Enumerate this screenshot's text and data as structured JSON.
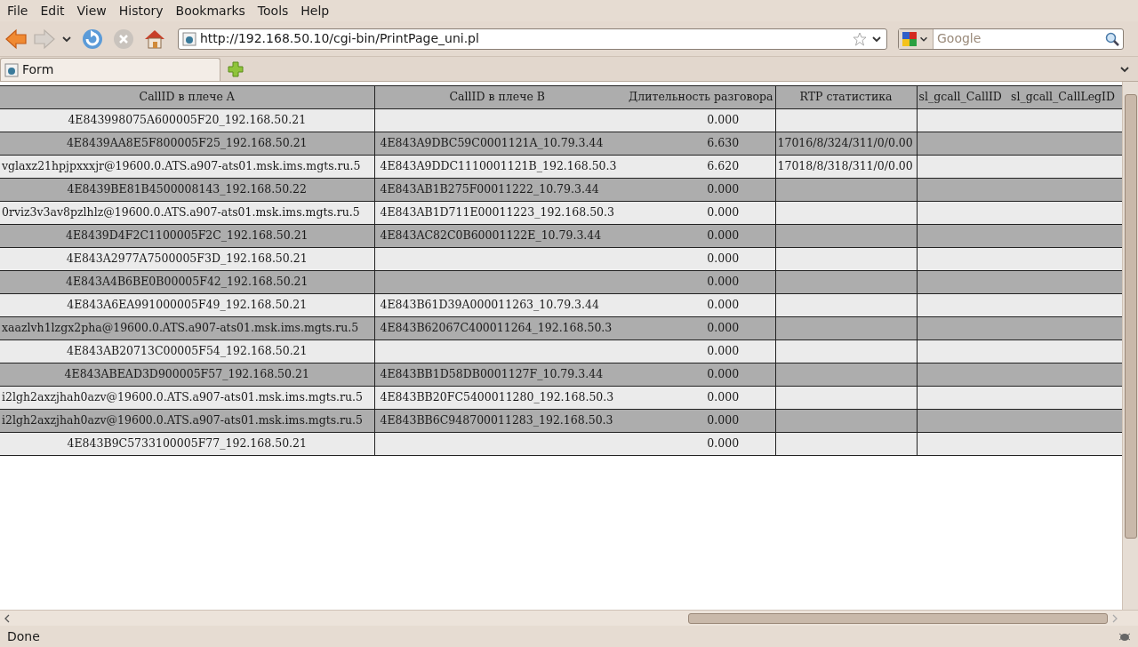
{
  "menu": [
    "File",
    "Edit",
    "View",
    "History",
    "Bookmarks",
    "Tools",
    "Help"
  ],
  "address_bar": {
    "url": "http://192.168.50.10/cgi-bin/PrintPage_uni.pl"
  },
  "search": {
    "placeholder": "Google"
  },
  "tabs": [
    {
      "label": "Form",
      "selected": true
    }
  ],
  "table": {
    "columns": [
      "CallID в плече A",
      "CallID в плече B",
      "Длительность разговора",
      "RTP статистика",
      "sl_gcall_CallID",
      "sl_gcall_CallLegID"
    ],
    "rows": [
      {
        "call_a": "4E843998075A600005F20_192.168.50.21",
        "duration": "0.000"
      },
      {
        "call_a": "4E8439AA8E5F800005F25_192.168.50.21",
        "call_b": "4E843A9DBC59C0001121A_10.79.3.44",
        "duration": "6.630",
        "rtp": "17016/8/324/311/0/0.00"
      },
      {
        "call_a": "vglaxz21hpjpxxxjr@19600.0.ATS.a907-ats01.msk.ims.mgts.ru.5",
        "call_b": "4E843A9DDC1110001121B_192.168.50.3",
        "duration": "6.620",
        "rtp": "17018/8/318/311/0/0.00"
      },
      {
        "call_a": "4E8439BE81B4500008143_192.168.50.22",
        "call_b": "4E843AB1B275F00011222_10.79.3.44",
        "duration": "0.000"
      },
      {
        "call_a": "0rviz3v3av8pzlhlz@19600.0.ATS.a907-ats01.msk.ims.mgts.ru.5",
        "call_b": "4E843AB1D711E00011223_192.168.50.3",
        "duration": "0.000"
      },
      {
        "call_a": "4E8439D4F2C1100005F2C_192.168.50.21",
        "call_b": "4E843AC82C0B60001122E_10.79.3.44",
        "duration": "0.000"
      },
      {
        "call_a": "4E843A2977A7500005F3D_192.168.50.21",
        "duration": "0.000"
      },
      {
        "call_a": "4E843A4B6BE0B00005F42_192.168.50.21",
        "duration": "0.000"
      },
      {
        "call_a": "4E843A6EA991000005F49_192.168.50.21",
        "call_b": "4E843B61D39A000011263_10.79.3.44",
        "duration": "0.000"
      },
      {
        "call_a": "xaazlvh1lzgx2pha@19600.0.ATS.a907-ats01.msk.ims.mgts.ru.5",
        "call_b": "4E843B62067C400011264_192.168.50.3",
        "duration": "0.000"
      },
      {
        "call_a": "4E843AB20713C00005F54_192.168.50.21",
        "duration": "0.000"
      },
      {
        "call_a": "4E843ABEAD3D900005F57_192.168.50.21",
        "call_b": "4E843BB1D58DB0001127F_10.79.3.44",
        "duration": "0.000"
      },
      {
        "call_a": "i2lgh2axzjhah0azv@19600.0.ATS.a907-ats01.msk.ims.mgts.ru.5",
        "call_b": "4E843BB20FC5400011280_192.168.50.3",
        "duration": "0.000"
      },
      {
        "call_a": "i2lgh2axzjhah0azv@19600.0.ATS.a907-ats01.msk.ims.mgts.ru.5",
        "call_b": "4E843BB6C948700011283_192.168.50.3",
        "duration": "0.000"
      },
      {
        "call_a": "4E843B9C5733100005F77_192.168.50.21",
        "duration": "0.000"
      }
    ]
  },
  "status_bar": {
    "text": "Done"
  }
}
